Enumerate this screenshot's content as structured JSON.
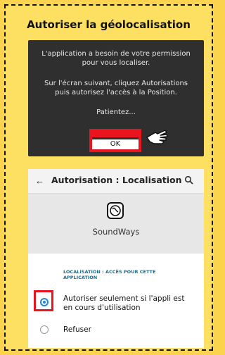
{
  "card": {
    "title": "Autoriser la géolocalisation"
  },
  "dialog": {
    "line1": "L'application a besoin de votre permission",
    "line2": "pour vous localiser.",
    "line3": "Sur l'écran suivant, cliquez Autorisations",
    "line4": "puis autorisez l'accès à la Position.",
    "line5": "Patientez...",
    "ok_label": "OK"
  },
  "screen": {
    "title": "Autorisation : Localisation",
    "app_name": "SoundWays",
    "section_label_1": "LOCALISATION : ACCÈS POUR CETTE",
    "section_label_2": "APPLICATION",
    "option1_line1": "Autoriser seulement si l'appli est",
    "option1_line2": "en cours d'utilisation",
    "option2": "Refuser"
  },
  "colors": {
    "highlight": "#e8141e",
    "accent": "#1e88e5",
    "background": "#fde061"
  }
}
